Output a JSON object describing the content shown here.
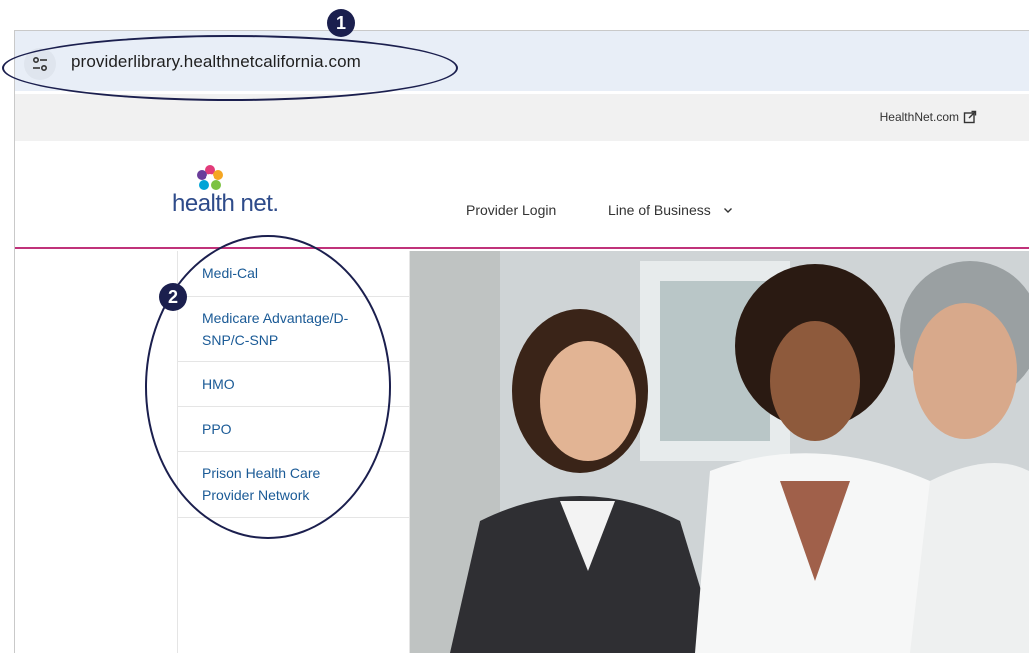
{
  "browser": {
    "url": "providerlibrary.healthnetcalifornia.com"
  },
  "topbar": {
    "external_link": "HealthNet.com"
  },
  "header": {
    "logo_text": "health net.",
    "nav": {
      "provider_login": "Provider Login",
      "line_of_business": "Line of Business"
    }
  },
  "side_menu": {
    "items": [
      {
        "label": "Medi-Cal"
      },
      {
        "label": "Medicare Advantage/D-SNP/C-SNP"
      },
      {
        "label": "HMO"
      },
      {
        "label": "PPO"
      },
      {
        "label": "Prison Health Care Provider Network"
      }
    ]
  },
  "annotations": {
    "badge1": "1",
    "badge2": "2"
  },
  "colors": {
    "accent_rule": "#c0327a",
    "link": "#1a5a96",
    "annotation": "#1b1f4e"
  }
}
